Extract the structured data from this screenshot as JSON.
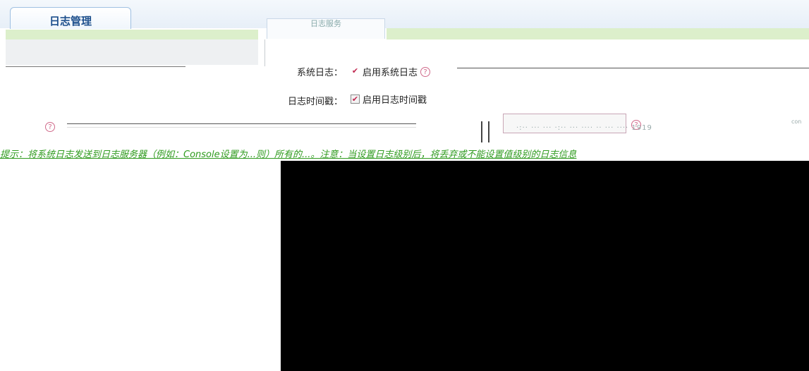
{
  "tabs": [
    {
      "label": "日志管理",
      "active": true
    },
    {
      "label": "日志服务",
      "active": false
    }
  ],
  "form": {
    "system_log": {
      "label": "系统日志：",
      "checkbox_label": "启用系统日志",
      "checked": true
    },
    "timestamp": {
      "label": "日志时间戳：",
      "checkbox_label": "启用日志时间戳",
      "checked": true
    }
  },
  "help_icon": "?",
  "notice": "提示：将系统日志发送到日志服务器（例如：Console设置为...则）所有的...。注意：当设置日志级别后，将丢弃或不能设置值级别的日志信息",
  "noise_text": "·:·· ··· ··· ·:·· ··· ···· ·· ··· ···· 1919",
  "colors": {
    "accent_green": "#2f9b1e",
    "tab_text": "#1d4f8c",
    "check_mark": "#c0264f"
  }
}
